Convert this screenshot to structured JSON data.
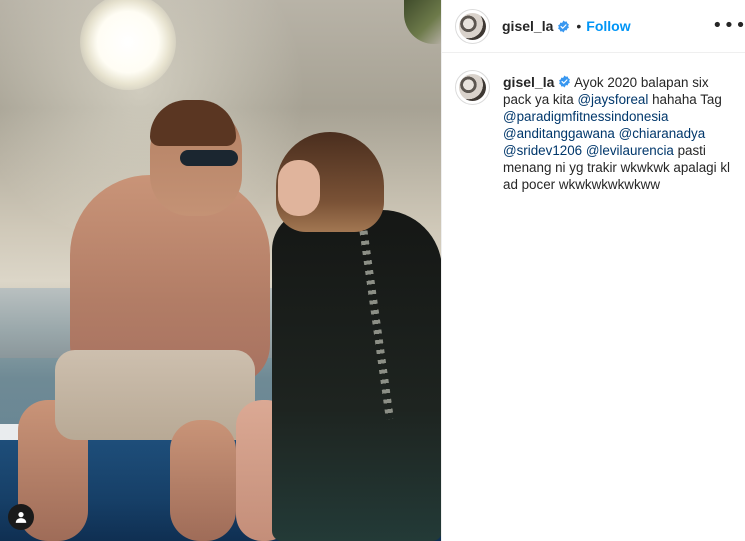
{
  "post": {
    "username": "gisel_la",
    "follow_label": "Follow",
    "more_label": "•••",
    "dot": "•"
  },
  "caption": {
    "username": "gisel_la",
    "part1": " Ayok 2020 balapan six pack ya kita ",
    "mention1": "@jaysforeal",
    "part2": " hahaha Tag ",
    "mention2": "@paradigmfitnessindonesia",
    "space1": " ",
    "mention3": "@anditanggawana",
    "space2": " ",
    "mention4": "@chiaranadya",
    "space3": " ",
    "mention5": "@sridev1206",
    "space4": " ",
    "mention6": "@levilaurencia",
    "part3": " pasti menang ni yg trakir wkwkwk apalagi kl ad pocer wkwkwkwkwkww"
  },
  "colors": {
    "link": "#00376b",
    "follow": "#0095f6",
    "verified": "#3897f0"
  },
  "icons": {
    "verified": "verified-badge-icon",
    "profile": "user-icon",
    "more": "more-options-icon"
  }
}
